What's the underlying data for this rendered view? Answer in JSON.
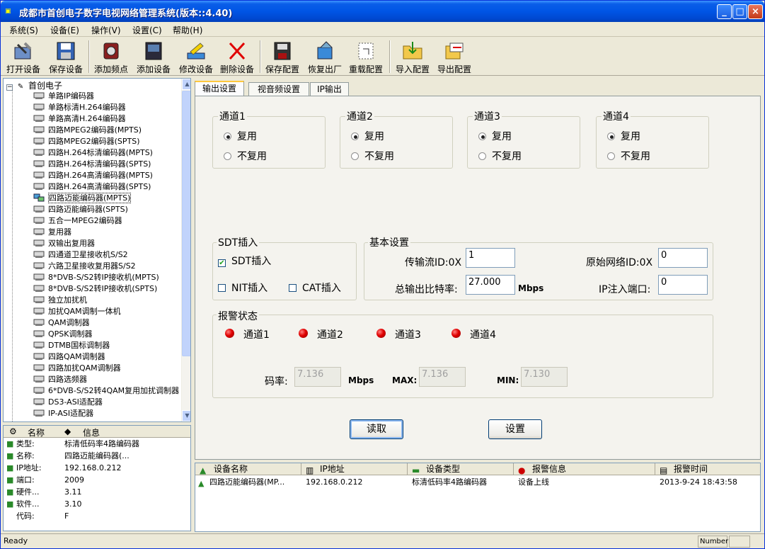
{
  "window": {
    "title": "成都市首创电子数字电视网络管理系统(版本::4.40)",
    "min": "_",
    "max": "□",
    "close": "×"
  },
  "menu": [
    "系统(S)",
    "设备(E)",
    "操作(V)",
    "设置(C)",
    "帮助(H)"
  ],
  "toolbar": [
    "打开设备",
    "保存设备",
    "添加频点",
    "添加设备",
    "修改设备",
    "删除设备",
    "保存配置",
    "恢复出厂",
    "重载配置",
    "导入配置",
    "导出配置"
  ],
  "tree": {
    "root": "首创电子",
    "items": [
      "单路IP编码器",
      "单路标清H.264编码器",
      "单路高清H.264编码器",
      "四路MPEG2编码器(MPTS)",
      "四路MPEG2编码器(SPTS)",
      "四路H.264标清编码器(MPTS)",
      "四路H.264标清编码器(SPTS)",
      "四路H.264高清编码器(MPTS)",
      "四路H.264高清编码器(SPTS)",
      "四路迈能编码器(MPTS)",
      "四路迈能编码器(SPTS)",
      "五合一MPEG2编码器",
      "复用器",
      "双输出复用器",
      "四通道卫星接收机S/S2",
      "六路卫星接收复用器S/S2",
      "8*DVB-S/S2转IP接收机(MPTS)",
      "8*DVB-S/S2转IP接收机(SPTS)",
      "独立加扰机",
      "加扰QAM调制一体机",
      "QAM调制器",
      "QPSK调制器",
      "DTMB国标调制器",
      "四路QAM调制器",
      "四路加扰QAM调制器",
      "四路选频器",
      "6*DVB-S/S2转4QAM复用加扰调制器",
      "DS3-ASI适配器",
      "IP-ASI适配器"
    ],
    "selected_index": 9
  },
  "info": {
    "col_name": "名称",
    "col_info": "信息",
    "rows": [
      {
        "k": "类型:",
        "v": "标清低码率4路编码器",
        "icon": "type-icon"
      },
      {
        "k": "名称:",
        "v": "四路迈能编码器(...",
        "icon": "name-icon"
      },
      {
        "k": "IP地址:",
        "v": "192.168.0.212",
        "icon": "ip-icon"
      },
      {
        "k": "端口:",
        "v": "2009",
        "icon": "port-icon"
      },
      {
        "k": "硬件...",
        "v": "3.11",
        "icon": "hardware-icon"
      },
      {
        "k": "软件...",
        "v": "3.10",
        "icon": "software-icon"
      },
      {
        "k": "代码:",
        "v": "F",
        "icon": ""
      }
    ]
  },
  "tabs": [
    "输出设置",
    "视音频设置",
    "IP输出"
  ],
  "channels": [
    {
      "title": "通道1",
      "opt1": "复用",
      "opt2": "不复用"
    },
    {
      "title": "通道2",
      "opt1": "复用",
      "opt2": "不复用"
    },
    {
      "title": "通道3",
      "opt1": "复用",
      "opt2": "不复用"
    },
    {
      "title": "通道4",
      "opt1": "复用",
      "opt2": "不复用"
    }
  ],
  "sdt": {
    "title": "SDT插入",
    "sdt_label": "SDT插入",
    "sdt_checked": true,
    "nit_label": "NIT插入",
    "cat_label": "CAT插入"
  },
  "basic": {
    "title": "基本设置",
    "tsid_label": "传输流ID:0X",
    "tsid_value": "1",
    "onid_label": "原始网络ID:0X",
    "onid_value": "0",
    "bitrate_label": "总输出比特率:",
    "bitrate_value": "27.000",
    "bitrate_unit": "Mbps",
    "ipport_label": "IP注入端口:",
    "ipport_value": "0"
  },
  "alarm": {
    "title": "报警状态",
    "channels": [
      "通道1",
      "通道2",
      "通道3",
      "通道4"
    ],
    "rate_label": "码率:",
    "rate_value": "7.136",
    "rate_unit": "Mbps",
    "max_label": "MAX:",
    "max_value": "7.136",
    "min_label": "MIN:",
    "min_value": "7.130",
    "led_color": "#e00000"
  },
  "buttons": {
    "read": "读取",
    "set": "设置"
  },
  "grid": {
    "headers": [
      "设备名称",
      "IP地址",
      "设备类型",
      "报警信息",
      "报警时间"
    ],
    "rows": [
      {
        "name": "四路迈能编码器(MP...",
        "ip": "192.168.0.212",
        "type": "标清低码率4路编码器",
        "alarm": "设备上线",
        "time": "2013-9-24 18:43:58"
      }
    ]
  },
  "status": {
    "text": "Ready",
    "number": "Number"
  }
}
